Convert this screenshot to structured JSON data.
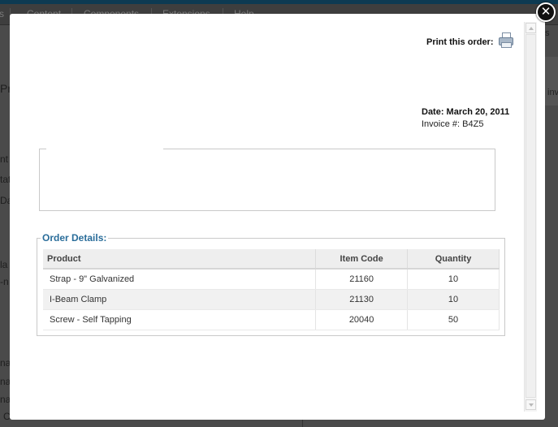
{
  "background": {
    "menu": [
      "s",
      "Content",
      "Components",
      "Extensions",
      "Help"
    ],
    "left_fragments": [
      "Pr",
      "nt",
      "tat",
      "Da",
      "la",
      "-n",
      "na",
      "na",
      "na",
      "C"
    ],
    "right_fragments": [
      "s",
      "inv"
    ]
  },
  "modal": {
    "print_label": "Print this order:",
    "date": "Date: March 20, 2011",
    "invoice": "Invoice #: B4Z5",
    "order_details_title": "Order Details:",
    "columns": [
      "Product",
      "Item Code",
      "Quantity"
    ],
    "rows": [
      {
        "product": "Strap - 9\" Galvanized",
        "code": "21160",
        "qty": "10"
      },
      {
        "product": "I-Beam Clamp",
        "code": "21130",
        "qty": "10"
      },
      {
        "product": "Screw - Self Tapping",
        "code": "20040",
        "qty": "50"
      }
    ],
    "close_symbol": "✕"
  }
}
